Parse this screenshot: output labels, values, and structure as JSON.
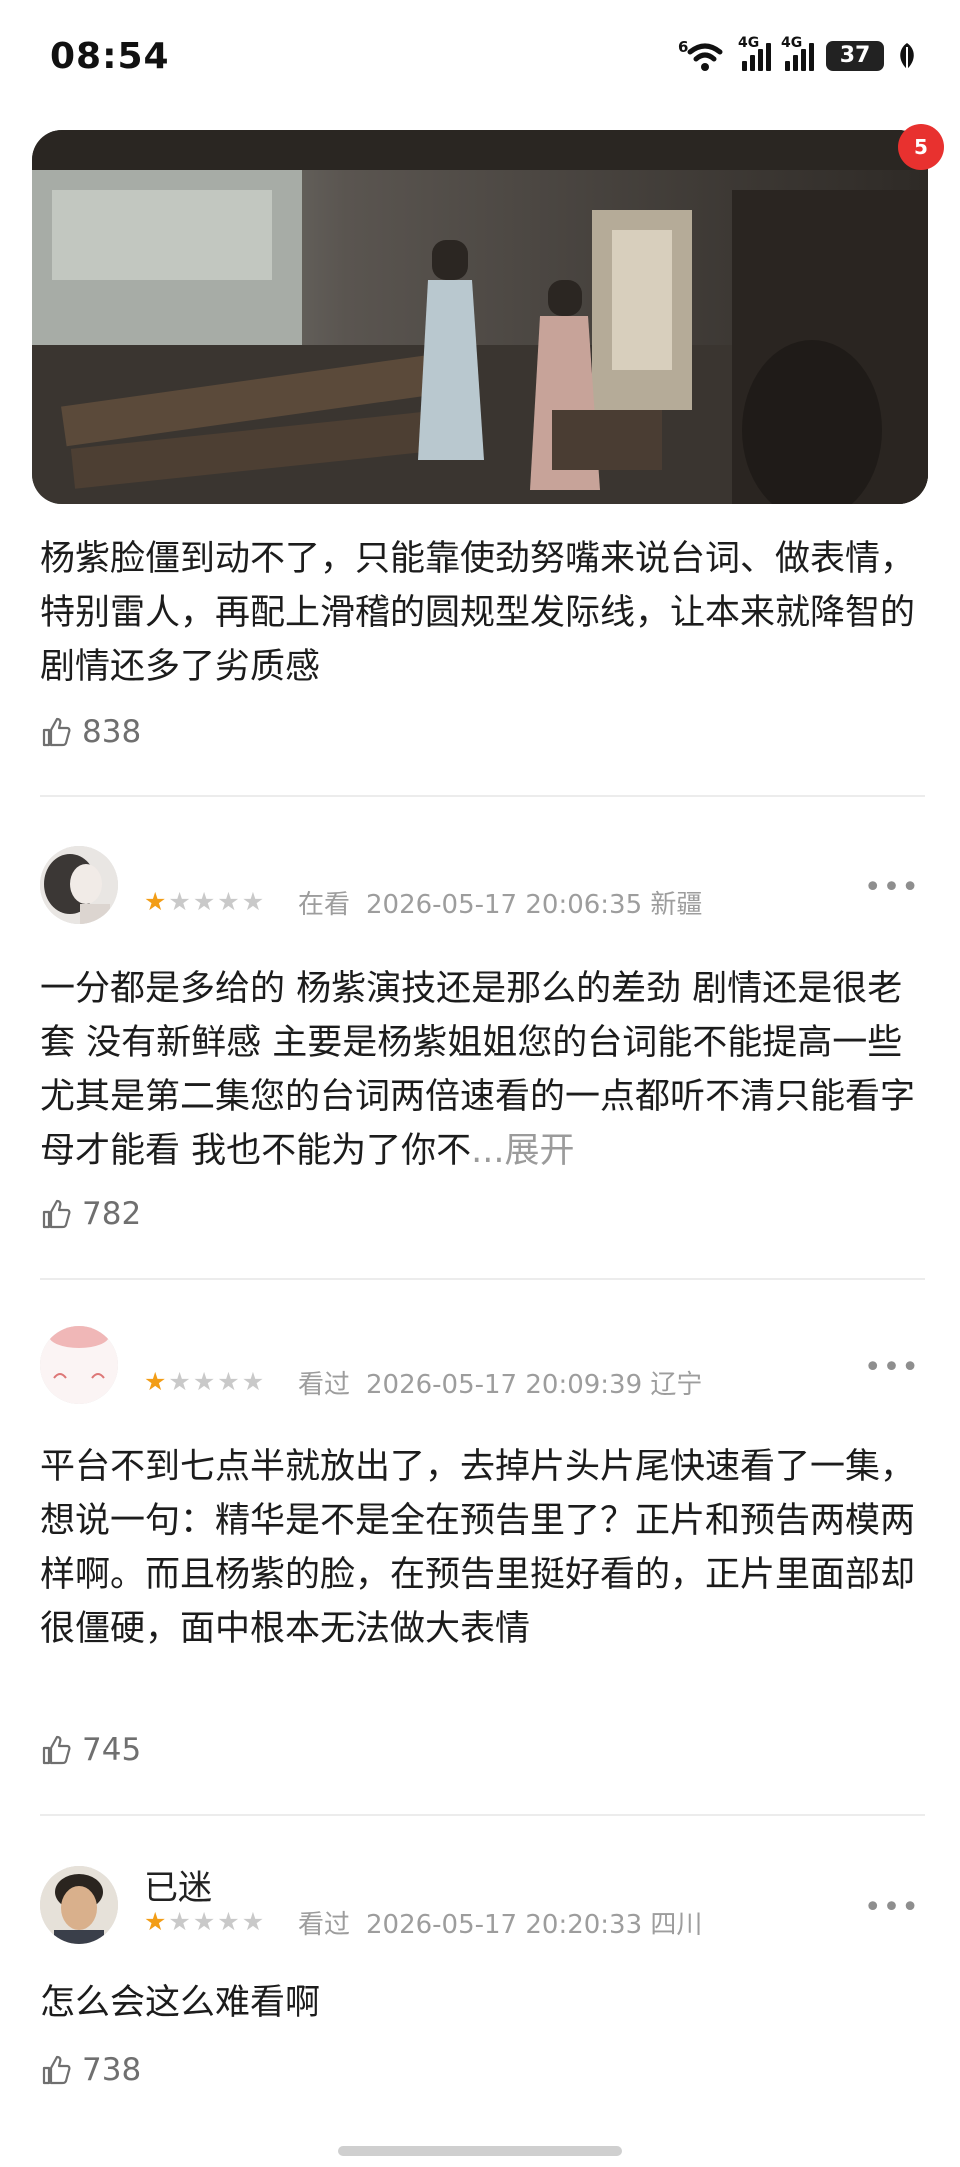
{
  "status_bar": {
    "time": "08:54",
    "wifi_badge": "6",
    "network_1": "4G",
    "network_2": "4G",
    "battery": "37"
  },
  "hero": {
    "notification_count": "5",
    "icon": "period-drama-still-image"
  },
  "reviews": [
    {
      "text": "杨紫脸僵到动不了，只能靠使劲努嘴来说台词、做表情，特别雷人，再配上滑稽的圆规型发际线，让本来就降智的剧情还多了劣质感",
      "likes": "838"
    },
    {
      "username": "",
      "rating": 1,
      "status": "在看",
      "date": "2026-05-17 20:06:35 新疆",
      "text": "一分都是多给的 杨紫演技还是那么的差劲 剧情还是很老套 没有新鲜感 主要是杨紫姐姐您的台词能不能提高一些 尤其是第二集您的台词两倍速看的一点都听不清只能看字母才能看 我也不能为了你不",
      "ellipsis": "...",
      "expand": "展开",
      "likes": "782"
    },
    {
      "username": "",
      "rating": 1,
      "status": "看过",
      "date": "2026-05-17 20:09:39 辽宁",
      "text": "平台不到七点半就放出了，去掉片头片尾快速看了一集，想说一句：精华是不是全在预告里了？正片和预告两模两样啊。而且杨紫的脸，在预告里挺好看的，正片里面部却很僵硬，面中根本无法做大表情",
      "likes": "745"
    },
    {
      "username": "已迷",
      "rating": 1,
      "status": "看过",
      "date": "2026-05-17 20:20:33 四川",
      "text": "怎么会这么难看啊",
      "likes": "738"
    }
  ],
  "more_glyph": "•••",
  "icons": [
    "wifi-icon",
    "signal-icon",
    "battery-icon",
    "leaf-icon",
    "thumbs-up-icon",
    "more-icon",
    "star-icon"
  ],
  "colors": {
    "star_active": "#f29d17",
    "star_inactive": "#c9c9c9",
    "meta_gray": "#9d9d9d",
    "badge_red": "#e8312f"
  }
}
